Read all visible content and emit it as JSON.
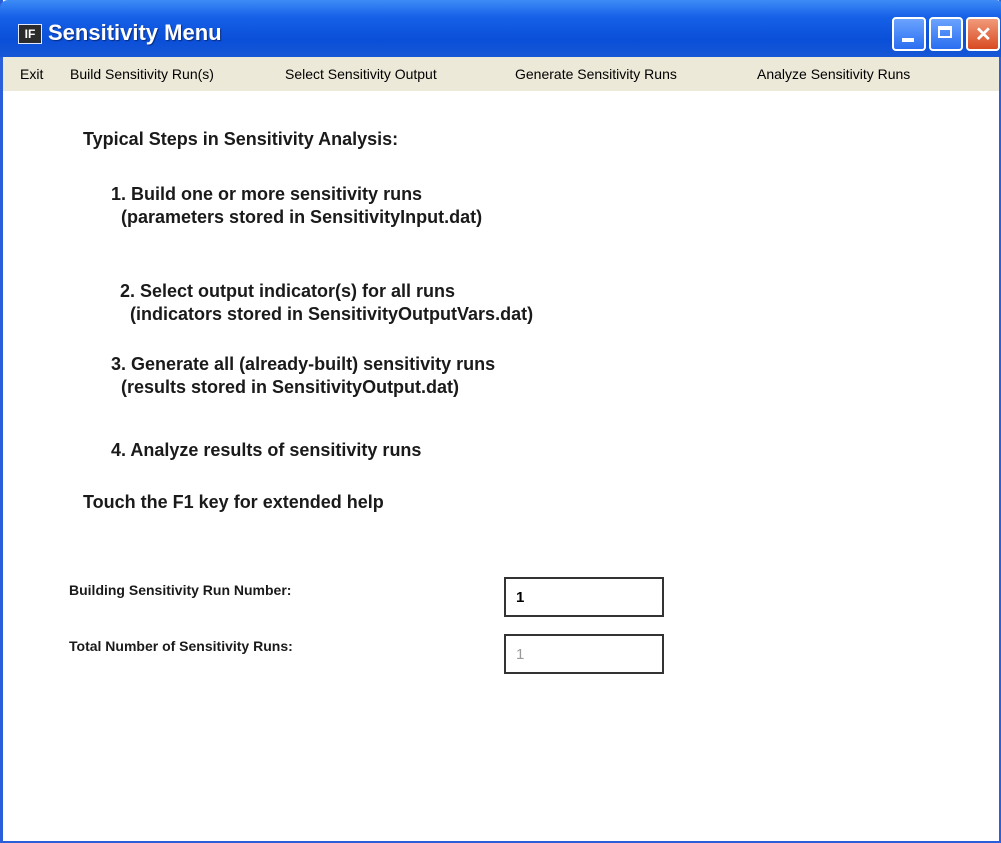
{
  "window": {
    "title": "Sensitivity Menu",
    "app_icon_text": "IF"
  },
  "menu": {
    "items": [
      {
        "label": "Exit"
      },
      {
        "label": "Build Sensitivity Run(s)"
      },
      {
        "label": "Select Sensitivity Output"
      },
      {
        "label": "Generate Sensitivity Runs"
      },
      {
        "label": "Analyze Sensitivity Runs"
      }
    ]
  },
  "content": {
    "heading": "Typical Steps in Sensitivity Analysis:",
    "steps": [
      {
        "line1": "1. Build one or more sensitivity runs",
        "line2": "(parameters stored in SensitivityInput.dat)"
      },
      {
        "line1": "2. Select output indicator(s) for all runs",
        "line2": "(indicators stored in SensitivityOutputVars.dat)"
      },
      {
        "line1": "3. Generate all (already-built) sensitivity runs",
        "line2": "(results stored in SensitivityOutput.dat)"
      },
      {
        "line1": "4. Analyze results of sensitivity runs"
      }
    ],
    "help_text": "Touch the F1 key for extended help"
  },
  "fields": {
    "building_run_label": "Building Sensitivity Run Number:",
    "building_run_value": "1",
    "total_runs_label": "Total Number of Sensitivity Runs:",
    "total_runs_value": "1"
  },
  "colors": {
    "titlebar": "#0a4fd8",
    "menubar": "#ece9d8",
    "close_button": "#d84a22"
  }
}
